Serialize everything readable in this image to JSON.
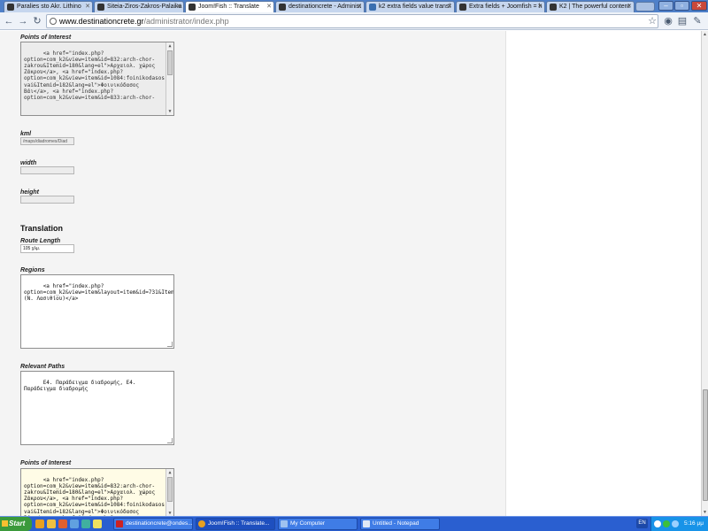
{
  "browser": {
    "tabs": [
      {
        "title": "Paralies sto Akr. Lithino",
        "active": false
      },
      {
        "title": "Siteia-Ziros-Zakros-Palaika",
        "active": false
      },
      {
        "title": "Joom!Fish :: Translate",
        "active": true
      },
      {
        "title": "destinationcrete - Administ",
        "active": false
      },
      {
        "title": "k2 extra fields value transl",
        "active": false
      },
      {
        "title": "Extra fields + Joomfish = h",
        "active": false
      },
      {
        "title": "K2 | The powerful content",
        "active": false
      }
    ],
    "url_host": "www.destinationcrete.gr",
    "url_path": "/administrator/index.php"
  },
  "form": {
    "original_points_label": "Points of Interest",
    "original_points_value": "<a href=\"index.php?option=com_k2&view=item&id=832:arch-chor-zakrou&Itemid=180&lang=el\">Αρχαιολ. χώρος Ζάκρου</a>, <a href=\"index.php?option=com_k2&view=item&id=1084:foinikodasos-vai&Itemid=182&lang=el\">Φοινικόδασος Βάι</a>, <a href=\"index.php?option=com_k2&view=item&id=833:arch-chor-",
    "kml_label": "kml",
    "kml_value": "/maps/diadromes/Diad",
    "width_label": "width",
    "width_value": "",
    "height_label": "height",
    "height_value": "",
    "translation_heading": "Translation",
    "route_length_label": "Route Length",
    "route_length_value": "105 χλμ.",
    "regions_label": "Regions",
    "regions_value": "<a href=\"index.php?option=com_k2&view=item&layout=item&id=731&Itemid=708\">Σητεία (Ν. Λασιθίου)</a>",
    "relevant_paths_label": "Relevant Paths",
    "relevant_paths_value": "Ε4. Παράδειγμα διαδρομής, Ε4. Παράδειγμα διαδρομής",
    "points_label": "Points of Interest",
    "points_value": "<a href=\"index.php?option=com_k2&view=item&id=832:arch-chor-zakrou&Itemid=180&lang=el\">Αρχαιολ. χώρος Ζάκρου</a>, <a href=\"index.php?option=com_k2&view=item&id=1084:foinikodasos-vai&Itemid=182&lang=el\">Φοινικόδασος Βάι</a>, <a href=\"index.php?option=com_k2&view=item&id=833:arch-chor-"
  },
  "taskbar": {
    "start_label": "Start",
    "tasks": [
      {
        "label": "destinationcrete@ondes...",
        "active": false
      },
      {
        "label": "Joom!Fish :: Translate...",
        "active": true
      },
      {
        "label": "My Computer",
        "active": false
      },
      {
        "label": "Untitled - Notepad",
        "active": false
      }
    ],
    "lang": "EN",
    "clock": "5:16 μμ"
  },
  "colors": {
    "chrome_frame": "#4f80c9",
    "taskbar": "#2a5fd0",
    "start_button": "#3b9a3b",
    "panel": "#f4f4f4",
    "yellow_field": "#fffce6"
  }
}
